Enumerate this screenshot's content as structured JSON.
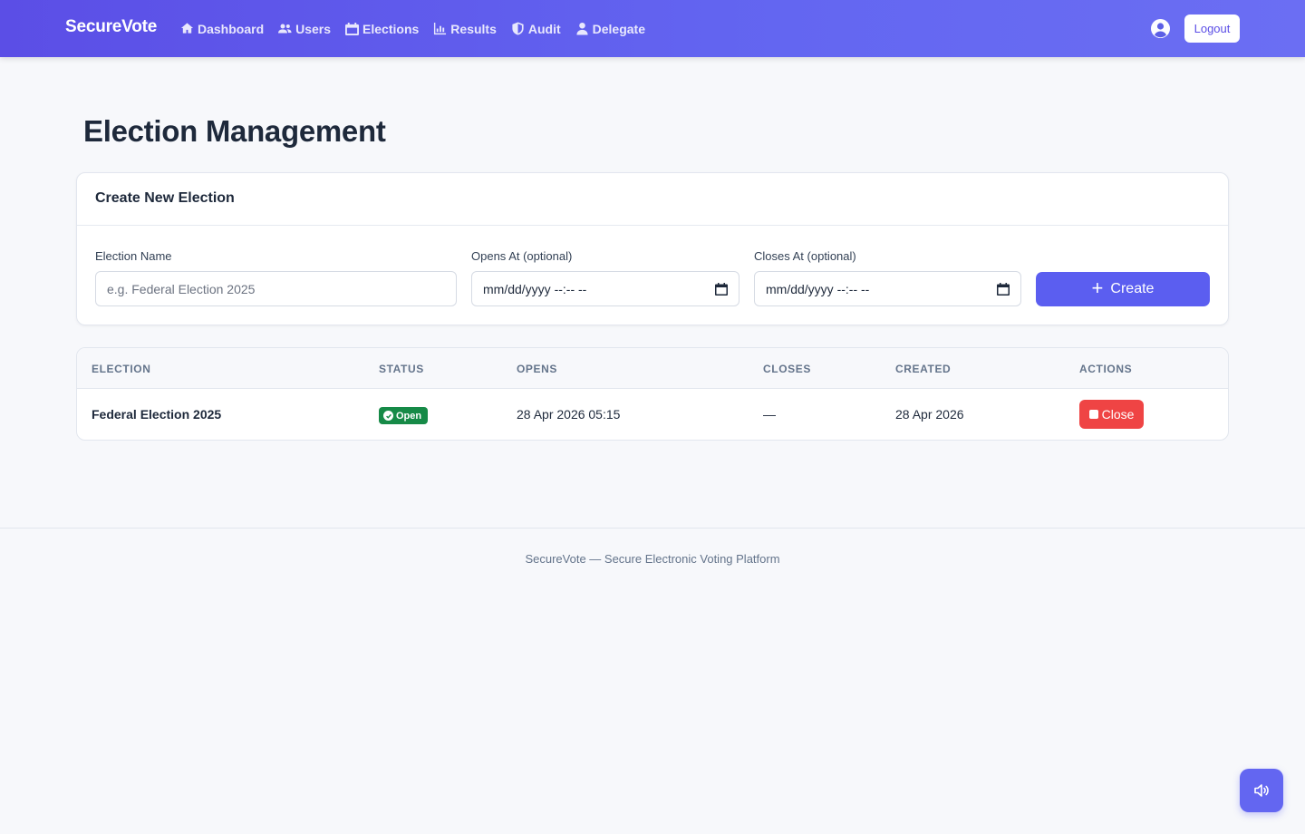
{
  "brand": "SecureVote",
  "nav": {
    "items": [
      {
        "label": "Dashboard",
        "icon": "home-icon"
      },
      {
        "label": "Users",
        "icon": "users-icon"
      },
      {
        "label": "Elections",
        "icon": "calendar-icon"
      },
      {
        "label": "Results",
        "icon": "chart-icon"
      },
      {
        "label": "Audit",
        "icon": "shield-icon"
      },
      {
        "label": "Delegate",
        "icon": "user-icon"
      }
    ],
    "logout_label": "Logout"
  },
  "page": {
    "title": "Election Management"
  },
  "create_form": {
    "title": "Create New Election",
    "name_label": "Election Name",
    "name_placeholder": "e.g. Federal Election 2025",
    "name_value": "",
    "opens_label": "Opens At (optional)",
    "opens_value": "mm/dd/yyyy --:-- --",
    "closes_label": "Closes At (optional)",
    "closes_value": "mm/dd/yyyy --:-- --",
    "create_label": "Create"
  },
  "table": {
    "columns": [
      "ELECTION",
      "STATUS",
      "OPENS",
      "CLOSES",
      "CREATED",
      "ACTIONS"
    ],
    "rows": [
      {
        "election": "Federal Election 2025",
        "status": "Open",
        "opens": "28 Apr 2026 05:15",
        "closes": "—",
        "created": "28 Apr 2026",
        "action_label": "Close"
      }
    ]
  },
  "footer": {
    "text": "SecureVote — Secure Electronic Voting Platform"
  },
  "colors": {
    "primary": "#6366f1",
    "status_open": "#168a47",
    "danger": "#ef4444"
  }
}
